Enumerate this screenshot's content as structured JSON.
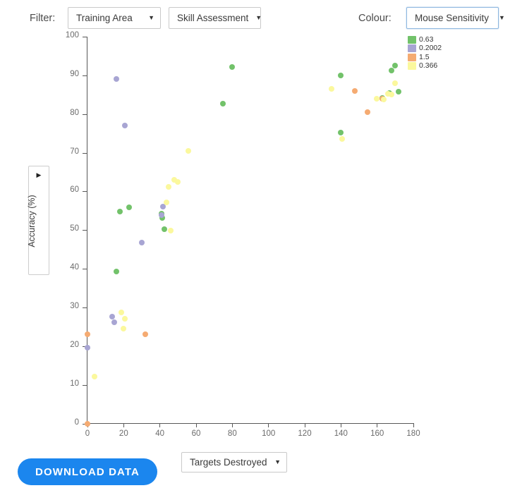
{
  "toolbar": {
    "filter_label": "Filter:",
    "colour_label": "Colour:",
    "filter_select_1": "Training Area",
    "filter_select_2": "Skill Assessment",
    "colour_select": "Mouse Sensitivity",
    "caret_glyph": "▼"
  },
  "footer": {
    "download_label": "DOWNLOAD DATA",
    "x_variable_select": "Targets Destroyed",
    "caret_glyph": "▼"
  },
  "y_axis_selector": {
    "label": "Accuracy (%)",
    "caret_glyph": "▶"
  },
  "legend": {
    "title": "Mouse Sensitivity",
    "entries": [
      {
        "label": "0.63",
        "color": "#72c26a"
      },
      {
        "label": "0.2002",
        "color": "#a8a5d3"
      },
      {
        "label": "1.5",
        "color": "#f5ab72"
      },
      {
        "label": "0.366",
        "color": "#fbf89d"
      }
    ]
  },
  "chart_data": {
    "type": "scatter",
    "title": "",
    "xlabel": "Targets Destroyed",
    "ylabel": "Accuracy (%)",
    "xlim": [
      0,
      180
    ],
    "ylim": [
      0,
      100
    ],
    "xticks": [
      0,
      20,
      40,
      60,
      80,
      100,
      120,
      140,
      160,
      180
    ],
    "yticks": [
      0,
      10,
      20,
      30,
      40,
      50,
      60,
      70,
      80,
      90,
      100
    ],
    "grid": false,
    "legend_position": "top-right",
    "color_by": "Mouse Sensitivity",
    "series": [
      {
        "name": "0.63",
        "color": "#72c26a",
        "points": [
          [
            16,
            39.2
          ],
          [
            18,
            54.8
          ],
          [
            23,
            55.8
          ],
          [
            41,
            54.2
          ],
          [
            41.5,
            53.2
          ],
          [
            42.5,
            50.2
          ],
          [
            75,
            82.6
          ],
          [
            80,
            92.2
          ],
          [
            140,
            90.0
          ],
          [
            140,
            75.2
          ],
          [
            163,
            84.2
          ],
          [
            167,
            85.5
          ],
          [
            168,
            91.2
          ],
          [
            170,
            92.5
          ],
          [
            172,
            85.8
          ]
        ]
      },
      {
        "name": "0.2002",
        "color": "#a8a5d3",
        "points": [
          [
            0,
            19.6
          ],
          [
            14,
            27.6
          ],
          [
            15,
            26.1
          ],
          [
            16,
            89.0
          ],
          [
            21,
            77.0
          ],
          [
            30,
            46.8
          ],
          [
            42,
            56.0
          ],
          [
            41,
            53.8
          ]
        ]
      },
      {
        "name": "1.5",
        "color": "#f5ab72",
        "points": [
          [
            0,
            23.0
          ],
          [
            0,
            0.0
          ],
          [
            32,
            23.0
          ],
          [
            148,
            85.9
          ],
          [
            155,
            80.5
          ],
          [
            163,
            84.0
          ]
        ]
      },
      {
        "name": "0.366",
        "color": "#fbf89d",
        "points": [
          [
            4,
            12.2
          ],
          [
            19,
            28.8
          ],
          [
            20,
            24.6
          ],
          [
            21,
            27.0
          ],
          [
            45,
            61.2
          ],
          [
            48,
            63.0
          ],
          [
            50,
            62.5
          ],
          [
            44,
            57.2
          ],
          [
            46,
            49.8
          ],
          [
            56,
            70.4
          ],
          [
            135,
            86.5
          ],
          [
            141,
            73.5
          ],
          [
            160,
            84.0
          ],
          [
            164,
            83.7
          ],
          [
            166,
            85.2
          ],
          [
            168,
            85.0
          ],
          [
            170,
            88.0
          ]
        ]
      }
    ]
  }
}
